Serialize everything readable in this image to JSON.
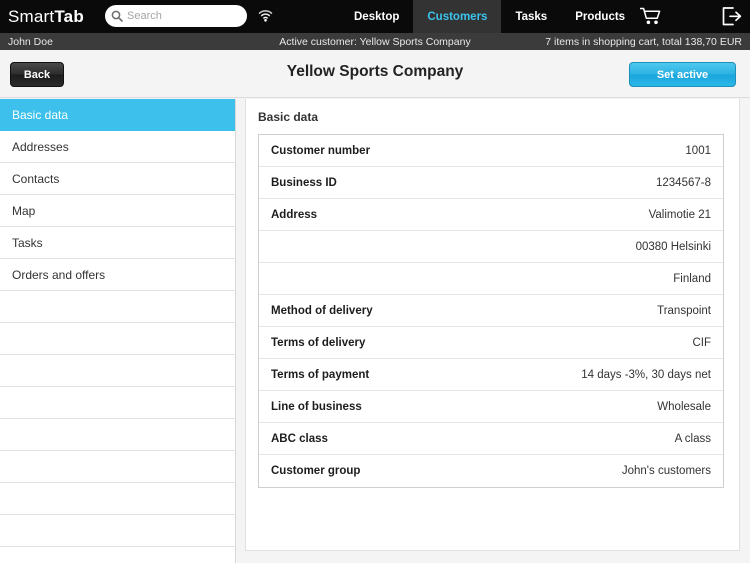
{
  "topbar": {
    "logo_light": "Smart",
    "logo_bold": "Tab",
    "search_placeholder": "Search",
    "search_value": "",
    "search_icon": "search-icon",
    "wifi_icon": "wifi-icon",
    "cart_icon": "shopping-cart-icon",
    "logout_icon": "logout-icon",
    "nav": [
      {
        "label": "Desktop",
        "active": false
      },
      {
        "label": "Customers",
        "active": true
      },
      {
        "label": "Tasks",
        "active": false
      },
      {
        "label": "Products",
        "active": false
      }
    ]
  },
  "statusbar": {
    "user": "John Doe",
    "active_customer": "Active customer: Yellow Sports Company",
    "cart_summary": "7 items in shopping cart, total 138,70 EUR"
  },
  "pageheader": {
    "back_label": "Back",
    "title": "Yellow Sports Company",
    "set_active_label": "Set active"
  },
  "sidebar": {
    "items": [
      {
        "label": "Basic data",
        "active": true
      },
      {
        "label": "Addresses",
        "active": false
      },
      {
        "label": "Contacts",
        "active": false
      },
      {
        "label": "Map",
        "active": false
      },
      {
        "label": "Tasks",
        "active": false
      },
      {
        "label": "Orders and offers",
        "active": false
      },
      {
        "label": "",
        "active": false
      },
      {
        "label": "",
        "active": false
      },
      {
        "label": "",
        "active": false
      },
      {
        "label": "",
        "active": false
      },
      {
        "label": "",
        "active": false
      },
      {
        "label": "",
        "active": false
      },
      {
        "label": "",
        "active": false
      },
      {
        "label": "",
        "active": false
      }
    ]
  },
  "content": {
    "section_title": "Basic data",
    "rows": [
      {
        "label": "Customer number",
        "value": "1001"
      },
      {
        "label": "Business ID",
        "value": "1234567-8"
      },
      {
        "label": "Address",
        "value": "Valimotie 21"
      },
      {
        "label": "",
        "value": "00380 Helsinki"
      },
      {
        "label": "",
        "value": "Finland"
      },
      {
        "label": "Method of delivery",
        "value": "Transpoint"
      },
      {
        "label": "Terms of delivery",
        "value": "CIF"
      },
      {
        "label": "Terms of payment",
        "value": "14 days -3%, 30 days net"
      },
      {
        "label": "Line of business",
        "value": "Wholesale"
      },
      {
        "label": "ABC class",
        "value": "A class"
      },
      {
        "label": "Customer group",
        "value": "John's customers"
      }
    ]
  },
  "colors": {
    "accent": "#3dc1ec",
    "topbar_bg": "#0a0a0a",
    "statusbar_bg": "#3b3b3b",
    "page_bg": "#f4f4f4"
  }
}
